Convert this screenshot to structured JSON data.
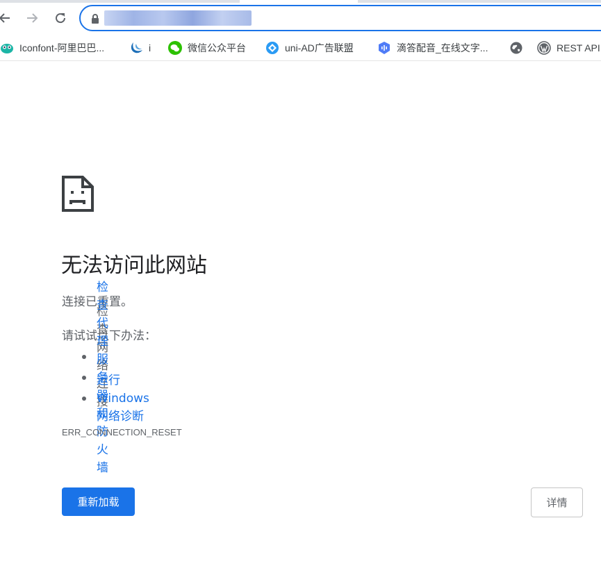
{
  "toolbar": {
    "back_icon": "arrow-left-icon",
    "forward_icon": "arrow-right-icon",
    "reload_icon": "reload-icon",
    "address_value": "",
    "lock_icon": "lock-icon"
  },
  "bookmarks": [
    {
      "label": "Iconfont-阿里巴巴...",
      "icon": "iconfont-icon"
    },
    {
      "label": "i",
      "icon": "jquery-icon"
    },
    {
      "label": "微信公众平台",
      "icon": "wechat-icon"
    },
    {
      "label": "uni-AD广告联盟",
      "icon": "uni-ad-icon"
    },
    {
      "label": "滴答配音_在线文字...",
      "icon": "voice-icon"
    },
    {
      "label": "",
      "icon": "globe-icon"
    },
    {
      "label": "REST API",
      "icon": "wordpress-icon"
    }
  ],
  "error": {
    "icon": "sad-page-icon",
    "title": "无法访问此网站",
    "subtitle": "连接已重置。",
    "try_label": "请试试以下办法：",
    "suggestions": [
      {
        "text": "检查网络连接",
        "link": false
      },
      {
        "text": "检查代理服务器和防火墙",
        "link": true
      },
      {
        "text": "运行 Windows 网络诊断",
        "link": true
      }
    ],
    "code": "ERR_CONNECTION_RESET",
    "reload_label": "重新加载",
    "details_label": "详情"
  },
  "colors": {
    "accent": "#1a73e8",
    "secondary_text": "#5f6368",
    "primary_text": "#202124"
  }
}
